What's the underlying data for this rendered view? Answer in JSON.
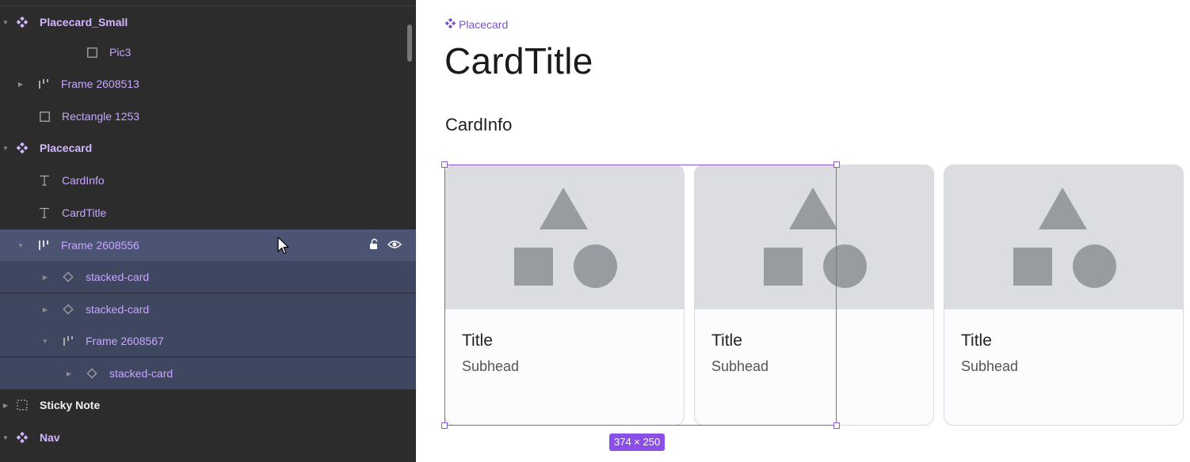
{
  "layers": {
    "rows": [
      {
        "name": "Placecard_Small",
        "icon": "component-icon"
      },
      {
        "name": "Pic3",
        "icon": "rectangle-icon"
      },
      {
        "name": "Frame 2608513",
        "icon": "frame-autolayout-icon"
      },
      {
        "name": "Rectangle 1253",
        "icon": "rectangle-icon"
      },
      {
        "name": "Placecard",
        "icon": "component-icon"
      },
      {
        "name": "CardInfo",
        "icon": "text-icon"
      },
      {
        "name": "CardTitle",
        "icon": "text-icon"
      },
      {
        "name": "Frame 2608556",
        "icon": "frame-autolayout-icon"
      },
      {
        "name": "stacked-card",
        "icon": "instance-icon"
      },
      {
        "name": "stacked-card",
        "icon": "instance-icon"
      },
      {
        "name": "Frame 2608567",
        "icon": "frame-autolayout-icon"
      },
      {
        "name": "stacked-card",
        "icon": "instance-icon"
      },
      {
        "name": "Sticky Note",
        "icon": "sticky-note-icon"
      },
      {
        "name": "Nav",
        "icon": "component-icon"
      }
    ]
  },
  "canvas": {
    "component_label": "Placecard",
    "card_title": "CardTitle",
    "card_info": "CardInfo",
    "cards": [
      {
        "title": "Title",
        "subhead": "Subhead"
      },
      {
        "title": "Title",
        "subhead": "Subhead"
      },
      {
        "title": "Title",
        "subhead": "Subhead"
      }
    ],
    "selection_size": "374 × 250"
  },
  "colors": {
    "panel_bg": "#2c2c2c",
    "selected_row": "#4b5573",
    "accent_purple": "#8a4fe6",
    "placeholder_fill": "#989ca0"
  }
}
